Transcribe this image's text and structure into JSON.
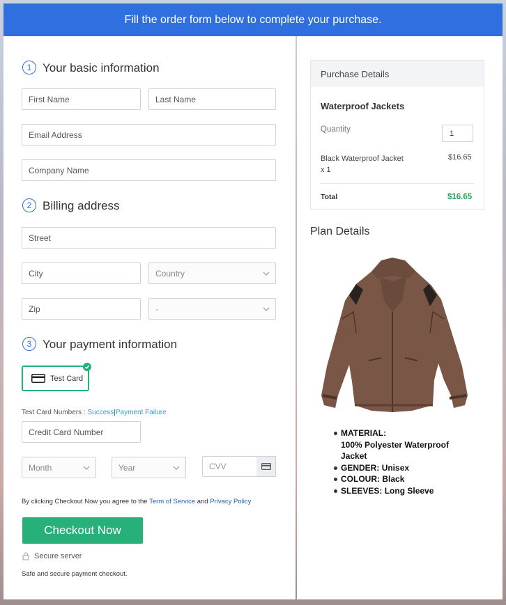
{
  "banner": {
    "text": "Fill the order form below to complete your purchase."
  },
  "sections": {
    "basic": {
      "number": "1",
      "title": "Your basic information"
    },
    "billing": {
      "number": "2",
      "title": "Billing address"
    },
    "payment": {
      "number": "3",
      "title": "Your payment information"
    }
  },
  "fields": {
    "first_name": "First Name",
    "last_name": "Last Name",
    "email": "Email Address",
    "company": "Company Name",
    "street": "Street",
    "city": "City",
    "country": "Country",
    "zip": "Zip",
    "state": "-",
    "credit_card": "Credit Card Number",
    "month": "Month",
    "year": "Year",
    "cvv": "CVV"
  },
  "payment": {
    "card_label": "Test Card",
    "test_numbers_label": "Test Card Numbers :",
    "success_link": "Success",
    "separator": "|",
    "failure_link": "Payment Failure"
  },
  "terms": {
    "prefix": "By clicking Checkout Now you agree to the",
    "terms_link": "Term of Service",
    "and": "and",
    "privacy_link": "Privacy Policy"
  },
  "checkout": {
    "button_label": "Checkout Now",
    "secure_label": "Secure server",
    "safe_text": "Safe and secure payment checkout."
  },
  "purchase_details": {
    "header": "Purchase Details",
    "product_name": "Waterproof Jackets",
    "quantity_label": "Quantity",
    "quantity_value": "1",
    "item_line1": "Black Waterproof Jacket",
    "item_line2": "x 1",
    "item_price": "$16.65",
    "total_label": "Total",
    "total_value": "$16.65"
  },
  "plan_details": {
    "title": "Plan Details",
    "specs": [
      {
        "label": "MATERIAL:",
        "value": "100% Polyester Waterproof Jacket"
      },
      {
        "label": "GENDER:",
        "value": "Unisex"
      },
      {
        "label": "COLOUR:",
        "value": "Black"
      },
      {
        "label": "SLEEVES:",
        "value": "Long Sleeve"
      }
    ]
  },
  "icons": {
    "card": "credit-card-icon",
    "check": "check-icon",
    "lock": "lock-icon",
    "chevron": "chevron-down-icon"
  },
  "colors": {
    "banner": "#2f6fe0",
    "accent_green": "#27b07a",
    "link": "#2aa4c9",
    "total": "#27a05a"
  }
}
